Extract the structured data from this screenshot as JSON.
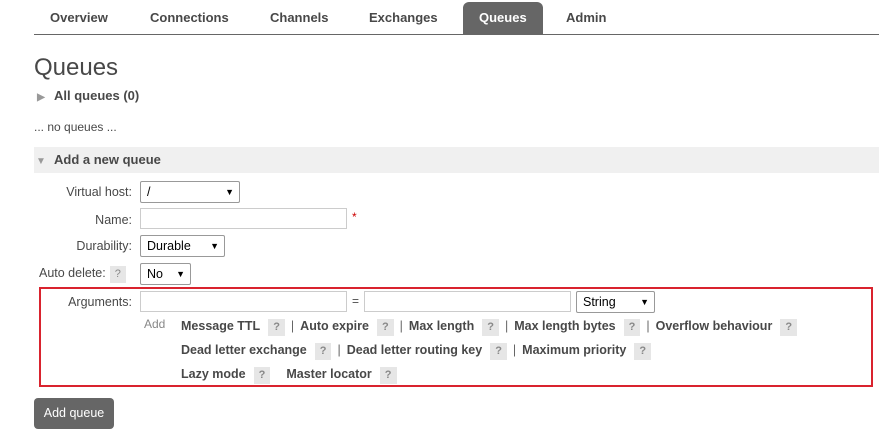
{
  "nav": {
    "tabs": [
      {
        "label": "Overview"
      },
      {
        "label": "Connections"
      },
      {
        "label": "Channels"
      },
      {
        "label": "Exchanges"
      },
      {
        "label": "Queues"
      },
      {
        "label": "Admin"
      }
    ],
    "active": "Queues"
  },
  "page": {
    "title": "Queues",
    "all_queues": "All queues (0)",
    "no_queues": "... no queues ...",
    "add_new_queue": "Add a new queue"
  },
  "form": {
    "virtual_host": {
      "label": "Virtual host:",
      "value": "/"
    },
    "name": {
      "label": "Name:",
      "value": "",
      "required_mark": "*"
    },
    "durability": {
      "label": "Durability:",
      "value": "Durable"
    },
    "auto_delete": {
      "label": "Auto delete:",
      "help": "?",
      "value": "No"
    },
    "arguments": {
      "label": "Arguments:",
      "key": "",
      "equals": "=",
      "value": "",
      "type": "String",
      "add": "Add",
      "options_row1": [
        "Message TTL",
        "Auto expire",
        "Max length",
        "Max length bytes",
        "Overflow behaviour"
      ],
      "options_row2": [
        "Dead letter exchange",
        "Dead letter routing key",
        "Maximum priority"
      ],
      "options_row3": [
        "Lazy mode",
        "Master locator"
      ],
      "help": "?",
      "separator": "|"
    },
    "submit": "Add queue"
  }
}
